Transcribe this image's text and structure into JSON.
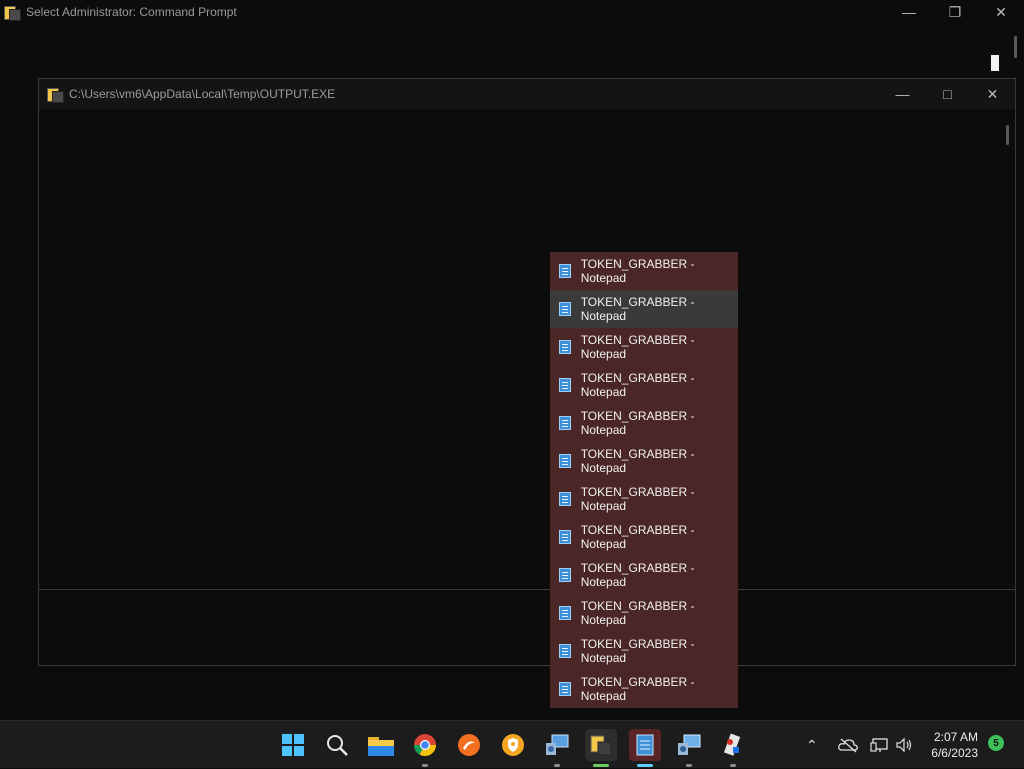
{
  "background_window": {
    "title": "Select Administrator:  Command Prompt",
    "caption_buttons": [
      "minimize-icon",
      "restore-icon",
      "close-icon"
    ]
  },
  "output_window": {
    "title": "C:\\Users\\vm6\\AppData\\Local\\Temp\\OUTPUT.EXE",
    "caption_buttons": [
      "minimize-icon",
      "maximize-icon",
      "close-icon"
    ]
  },
  "jumplist": {
    "items": [
      "TOKEN_GRABBER - Notepad",
      "TOKEN_GRABBER - Notepad",
      "TOKEN_GRABBER - Notepad",
      "TOKEN_GRABBER - Notepad",
      "TOKEN_GRABBER - Notepad",
      "TOKEN_GRABBER - Notepad",
      "TOKEN_GRABBER - Notepad",
      "TOKEN_GRABBER - Notepad",
      "TOKEN_GRABBER - Notepad",
      "TOKEN_GRABBER - Notepad",
      "TOKEN_GRABBER - Notepad",
      "TOKEN_GRABBER - Notepad"
    ],
    "background_color": "#4a2626",
    "hover_index": 1
  },
  "taskbar": {
    "icons": [
      "start-icon",
      "search-icon",
      "file-explorer-icon",
      "chrome-icon",
      "app-orange-icon",
      "app-shield-icon",
      "control-panel-icon",
      "cmd-icon",
      "notepad-icon",
      "network-app-icon",
      "paint-app-icon"
    ],
    "tray": {
      "time": "2:07 AM",
      "date": "6/6/2023",
      "notification_count": "5"
    }
  }
}
